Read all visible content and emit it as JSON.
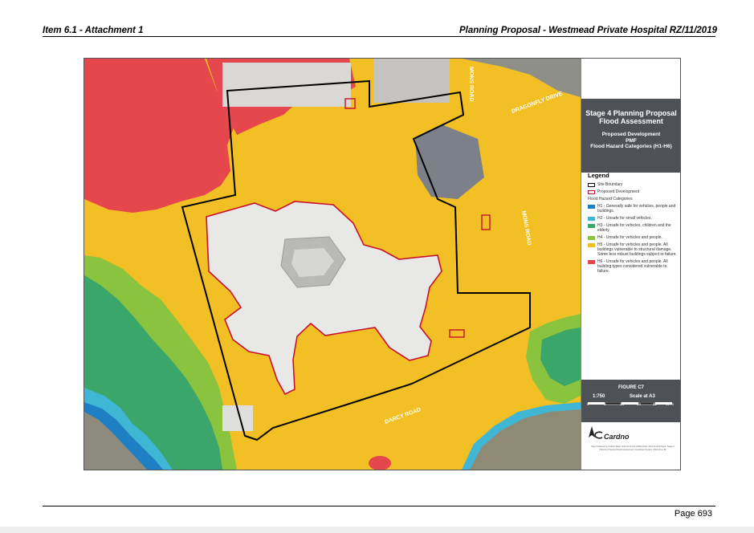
{
  "header": {
    "left": "Item 6.1 - Attachment 1",
    "right": "Planning Proposal - Westmead Private Hospital RZ/11/2019"
  },
  "footer": {
    "page": "Page 693"
  },
  "map": {
    "roads": {
      "mons_road_top": "MONS ROAD",
      "dragonfly_drive": "DRAGONFLY DRIVE",
      "mons_road_side": "MONS ROAD",
      "darcy_road": "DARCY ROAD"
    },
    "colors": {
      "H1": "#1f7fc4",
      "H2": "#3fb6d4",
      "H3": "#3aa66a",
      "H4": "#8ac43f",
      "H5": "#f2c024",
      "H6": "#e6474d",
      "site_boundary": "#000000",
      "proposed_development": "#c8102e",
      "panel_dark": "#4e5257"
    }
  },
  "panel": {
    "title": "Stage 4 Planning Proposal Flood Assessment",
    "subtitle_1": "Proposed Development",
    "subtitle_2": "PMF",
    "subtitle_3": "Flood Hazard Categories (H1-H6)",
    "legend": {
      "title": "Legend",
      "site_boundary": "Site Boundary",
      "proposed_development": "Proposed Development",
      "hazard_heading": "Flood Hazard Categories",
      "items": [
        {
          "code": "H1",
          "label": "H1 - Generally safe for vehicles, people and buildings."
        },
        {
          "code": "H2",
          "label": "H2 - Unsafe for small vehicles."
        },
        {
          "code": "H3",
          "label": "H3 - Unsafe for vehicles, children and the elderly."
        },
        {
          "code": "H4",
          "label": "H4 - Unsafe for vehicles and people."
        },
        {
          "code": "H5",
          "label": "H5 - Unsafe for vehicles and people. All buildings vulnerable to structural damage. Some less robust buildings subject to failure."
        },
        {
          "code": "H6",
          "label": "H6 - Unsafe for vehicles and people. All building types considered vulnerable to failure."
        }
      ]
    },
    "figure": {
      "title": "FIGURE C7",
      "scale": "1:750",
      "scale_label": "Scale at A3",
      "ticks": [
        "0",
        "8",
        "16",
        "24",
        "32",
        "40 m"
      ]
    },
    "logo": "Cardno",
    "fine_print": "Map Produced by Cardno Water & Environment (NSW) Date: 2021-11-26 Project: Stage 4 Planning Proposal Flood Assessment Coordinate System: MGA Zone 56"
  }
}
